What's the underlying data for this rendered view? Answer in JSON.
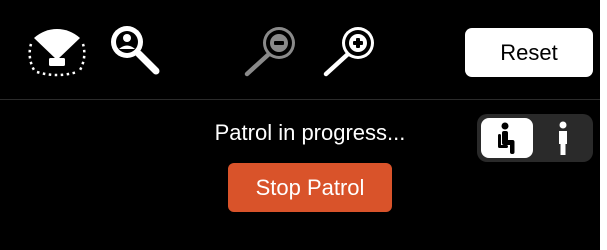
{
  "toolbar": {
    "icons": {
      "view_angle": "view-angle-icon",
      "person_search": "person-search-icon",
      "zoom_out": "zoom-out-icon",
      "zoom_in": "zoom-in-icon"
    },
    "reset_label": "Reset"
  },
  "patrol": {
    "status_text": "Patrol in progress...",
    "stop_label": "Stop Patrol"
  },
  "mode_toggle": {
    "options": [
      {
        "icon": "seated-person-icon",
        "selected": true
      },
      {
        "icon": "standing-person-icon",
        "selected": false
      }
    ]
  },
  "colors": {
    "background": "#000000",
    "stop_button": "#d9532a",
    "reset_button": "#ffffff",
    "disabled_icon": "#8a8a8a",
    "toggle_track": "#2a2a2a"
  }
}
